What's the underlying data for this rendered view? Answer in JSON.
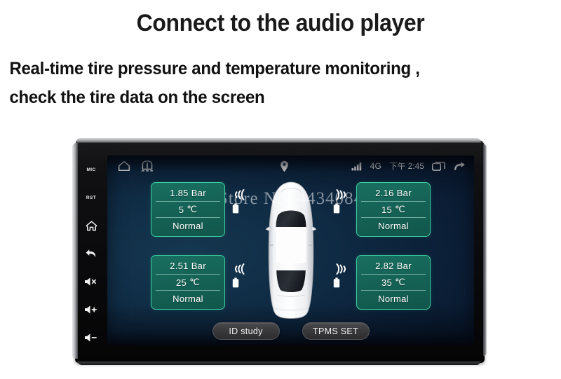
{
  "headings": {
    "title": "Connect to the audio player",
    "subtitle_line1": "Real-time tire pressure and temperature monitoring ,",
    "subtitle_line2": "check the tire data on the screen"
  },
  "device": {
    "hard_keys": [
      {
        "name": "mic",
        "label": "MIC",
        "type": "text"
      },
      {
        "name": "reset",
        "label": "RST",
        "type": "text"
      },
      {
        "name": "home",
        "label": "",
        "type": "icon"
      },
      {
        "name": "back",
        "label": "",
        "type": "icon"
      },
      {
        "name": "mute",
        "label": "",
        "type": "icon"
      },
      {
        "name": "volume-up",
        "label": "",
        "type": "icon"
      },
      {
        "name": "volume-down",
        "label": "",
        "type": "icon"
      }
    ]
  },
  "status_bar": {
    "home_icon": "home-icon",
    "tpms_warning_icon": "tire-pressure-warning-icon",
    "location_icon": "location-pin-icon",
    "signal_icon": "cellular-signal-icon",
    "network": "4G",
    "clock": "下午 2:45",
    "recents_icon": "recent-apps-icon",
    "back_icon": "back-arrow-icon"
  },
  "watermark": "Store No: 4434084",
  "colors": {
    "card_border": "#3ecfa0",
    "card_fill": "#156356",
    "screen_bg": "#0f2a43",
    "button_fill": "#3a3a3c",
    "text": "#ffffff"
  },
  "tpms": {
    "unit_pressure": "Bar",
    "unit_temperature": "℃",
    "tires": [
      {
        "position": "front-left",
        "pressure": "1.85",
        "pressure_unit": "Bar",
        "temperature": "5",
        "temperature_unit": "℃",
        "status": "Normal"
      },
      {
        "position": "front-right",
        "pressure": "2.16",
        "pressure_unit": "Bar",
        "temperature": "15",
        "temperature_unit": "℃",
        "status": "Normal"
      },
      {
        "position": "rear-left",
        "pressure": "2.51",
        "pressure_unit": "Bar",
        "temperature": "25",
        "temperature_unit": "℃",
        "status": "Normal"
      },
      {
        "position": "rear-right",
        "pressure": "2.82",
        "pressure_unit": "Bar",
        "temperature": "35",
        "temperature_unit": "℃",
        "status": "Normal"
      }
    ],
    "sensor_icons": {
      "signal": "sensor-signal-waves-icon",
      "battery": "sensor-battery-icon"
    },
    "vehicle_icon": "car-top-view-icon"
  },
  "buttons": {
    "id_study": "ID study",
    "tpms_set": "TPMS SET"
  }
}
